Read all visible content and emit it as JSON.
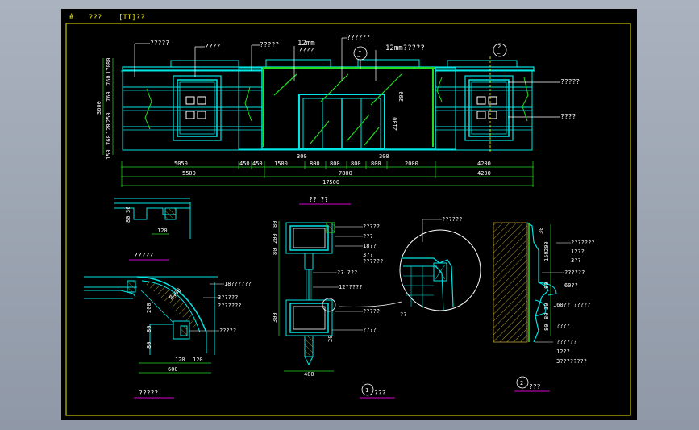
{
  "colors": {
    "background": "#000000",
    "frame": "#e8e800",
    "linework": "#00e5e5",
    "dimension": "#22dd22",
    "leader": "#ffffff",
    "title_underline": "#d000d0",
    "hatch": "#b8a030"
  },
  "title_block": {
    "symbol": "#",
    "text_a": "???",
    "text_b": "[II]??"
  },
  "elevation": {
    "callouts": [
      "?????",
      "????",
      "?????",
      "12mm",
      "????",
      "??????",
      "12mm?????",
      "?????",
      "????"
    ],
    "section_tags": [
      {
        "number": "1",
        "sheet": "—"
      },
      {
        "number": "2",
        "sheet": "—"
      }
    ],
    "left_dims": [
      "80",
      "170",
      "760",
      "760",
      "250",
      "120",
      "760",
      "150"
    ],
    "height_total": "3600",
    "door_height": "2100",
    "door_offsets": [
      "300",
      "300"
    ],
    "door_top_dim": "300",
    "dims_row1": [
      "5050",
      "450",
      "450",
      "1500",
      "800",
      "800",
      "800",
      "800",
      "2000",
      "4200"
    ],
    "dims_row2": [
      "5500",
      "7800",
      "4200"
    ],
    "dims_total": "17500",
    "title": "?? ??"
  },
  "detail_ul": {
    "dims": [
      "80",
      "30",
      "120"
    ],
    "title": "?????"
  },
  "detail_ll": {
    "callouts": [
      "18??????",
      "3?????",
      "???????",
      "?????"
    ],
    "radius": "R400",
    "dims_vertical": [
      "200",
      "80",
      "80"
    ],
    "dims_h1": [
      "120",
      "120"
    ],
    "dims_total": "600",
    "title": "?????"
  },
  "detail_center": {
    "callouts": [
      "?????",
      "???",
      "18??",
      "3??",
      "??????",
      "?? ???",
      "12?????",
      "?????",
      "????",
      "??"
    ],
    "dims_top": [
      "80",
      "200",
      "80"
    ],
    "dims_bottom": [
      "300",
      "20"
    ],
    "width": "400",
    "title_number": "1",
    "title": "???"
  },
  "detail_circle": {
    "callout": "??????"
  },
  "detail_right": {
    "callouts": [
      "???????",
      "12??",
      "3??",
      "??????",
      "60??",
      "160?? ?????",
      "????",
      "??????",
      "12??",
      "3????????"
    ],
    "dims": [
      "30",
      "200",
      "150",
      "80",
      "30",
      "80",
      "80"
    ],
    "title_number": "2",
    "title": "???"
  }
}
